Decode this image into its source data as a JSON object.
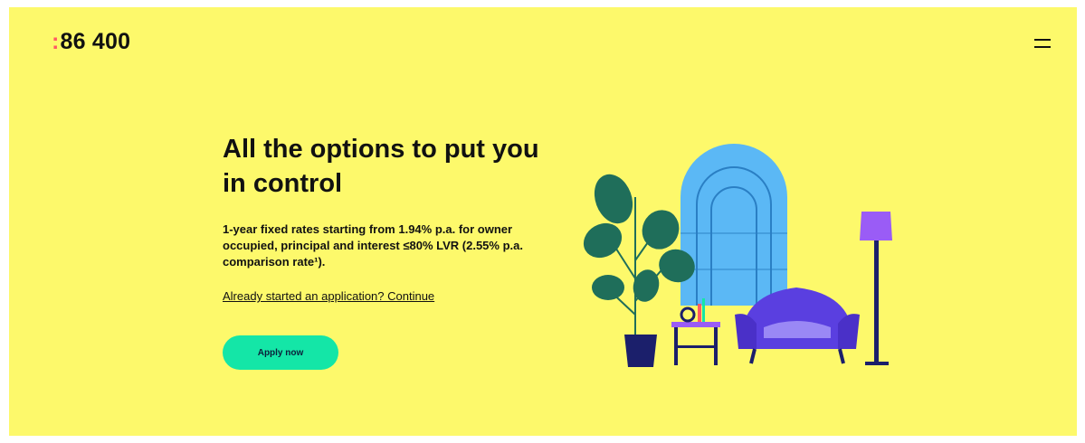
{
  "header": {
    "logo_colon": ":",
    "logo_text": "86 400",
    "menu_icon": "hamburger-menu-icon"
  },
  "hero": {
    "headline": "All the options to put you in control",
    "subtext": "1-year fixed rates starting from 1.94% p.a. for owner occupied, principal and interest ≤80% LVR (2.55% p.a. comparison rate¹).",
    "continue_link": "Already started an application? Continue",
    "apply_button": "Apply now"
  },
  "illustration": {
    "name": "living-room-illustration",
    "colors": {
      "background": "#fdf96b",
      "window": "#5bb8f5",
      "plant": "#1f6e5a",
      "pot": "#1b1f6b",
      "armchair": "#5a3fe0",
      "lamp_shade": "#9a5cf6",
      "accent_green": "#14e6a7"
    }
  }
}
